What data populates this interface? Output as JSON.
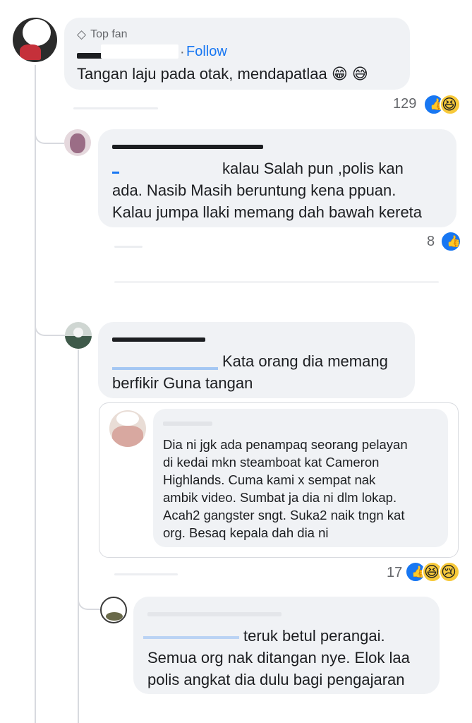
{
  "comments": [
    {
      "badge": "Top fan",
      "follow": "Follow",
      "text": "Tangan laju pada otak, mendapatlaa",
      "emojis": [
        "😁",
        "😅"
      ],
      "count": "129",
      "reactions": [
        "like-icon",
        "haha-icon"
      ]
    },
    {
      "lines": [
        "kalau Salah pun ,polis kan",
        "ada. Nasib Masih beruntung kena ppuan.",
        "Kalau jumpa llaki memang dah bawah kereta"
      ],
      "count": "8",
      "reactions": [
        "like-icon"
      ]
    },
    {
      "lines": [
        "Kata orang dia memang",
        "berfikir Guna tangan"
      ],
      "count": "17",
      "reactions": [
        "like-icon",
        "haha-icon",
        "sad-icon"
      ]
    },
    {
      "lines": [
        "Dia ni jgk ada penampaq seorang pelayan",
        "di kedai mkn steamboat kat Cameron",
        "Highlands. Cuma kami x sempat nak",
        "ambik video. Sumbat ja dia ni dlm lokap.",
        "Acah2 gangster sngt. Suka2 naik tngn kat",
        "org. Besaq kepala dah dia ni"
      ]
    },
    {
      "lines": [
        "teruk betul perangai.",
        "Semua org nak ditangan nye. Elok laa",
        "polis angkat dia dulu bagi pengajaran"
      ]
    }
  ],
  "colors": {
    "link": "#1877f2",
    "bubble": "#f0f2f5",
    "muted": "#65676b"
  }
}
